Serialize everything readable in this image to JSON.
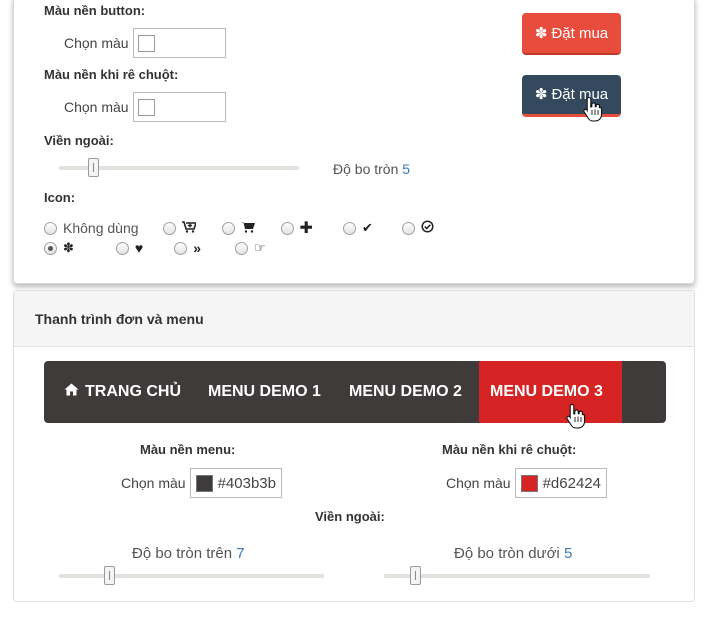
{
  "button_settings": {
    "bg_label": "Màu nền button:",
    "bg_picker_label": "Chọn màu",
    "hover_label": "Màu nền khi rê chuột:",
    "hover_picker_label": "Chọn màu",
    "border_label": "Viền ngoài:",
    "radius_label": "Độ bo tròn",
    "radius_value": "5",
    "radius_level": 5,
    "icon_label": "Icon:",
    "preview_button_label": "Đặt mua",
    "preview_hover_label": "Đặt mua",
    "icon_options": [
      {
        "label": "Không dùng",
        "icon": "none",
        "checked": false
      },
      {
        "icon": "cart-plus-icon",
        "checked": false
      },
      {
        "icon": "cart-icon",
        "checked": false
      },
      {
        "icon": "plus-icon",
        "checked": false
      },
      {
        "icon": "check-icon",
        "checked": false
      },
      {
        "icon": "check-circle-icon",
        "checked": false
      },
      {
        "icon": "yelp-icon",
        "checked": true
      },
      {
        "icon": "heart-icon",
        "checked": false
      },
      {
        "icon": "double-angle-right-icon",
        "checked": false
      },
      {
        "icon": "hand-pointer-icon",
        "checked": false
      }
    ],
    "colors": {
      "button_bg": "#e74c3c",
      "hover_bg": "#34495e"
    }
  },
  "menu_settings": {
    "heading": "Thanh trình đơn và menu",
    "menu_items": [
      {
        "label": "TRANG CHỦ",
        "icon": "home-icon"
      },
      {
        "label": "MENU DEMO 1"
      },
      {
        "label": "MENU DEMO 2"
      },
      {
        "label": "MENU DEMO 3",
        "active": true
      }
    ],
    "menu_bg_label": "Màu nền menu:",
    "menu_bg_picker_label": "Chọn màu",
    "menu_bg_value": "#403b3b",
    "hover_bg_label": "Màu nền khi rê chuột:",
    "hover_bg_picker_label": "Chọn màu",
    "hover_bg_value": "#d62424",
    "border_label": "Viền ngoài:",
    "radius_top_label": "Độ bo tròn trên",
    "radius_top_value": "7",
    "radius_top_level": 7,
    "radius_bottom_label": "Độ bo tròn dưới",
    "radius_bottom_value": "5",
    "radius_bottom_level": 5
  }
}
